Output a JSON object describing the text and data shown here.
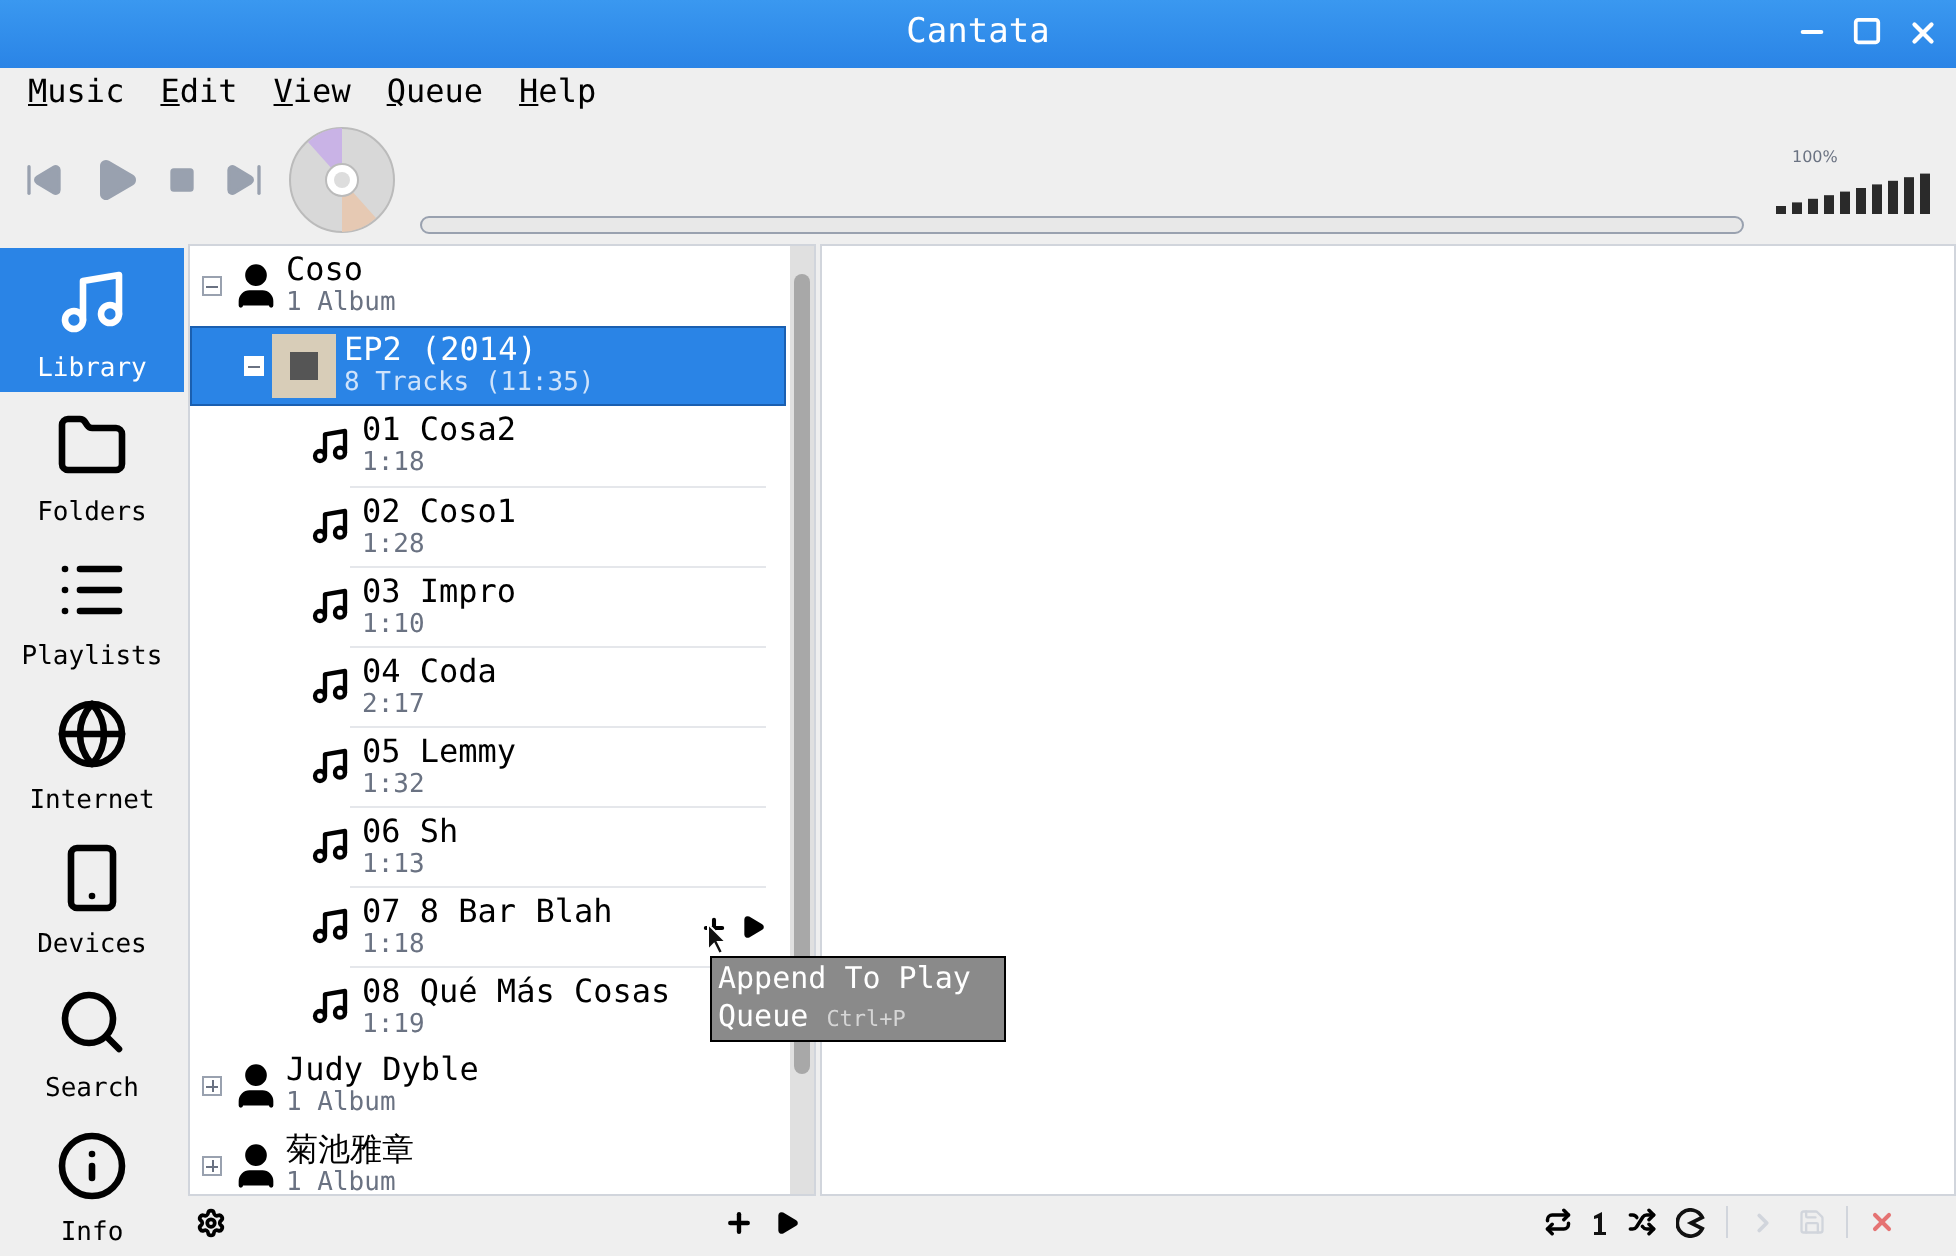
{
  "window": {
    "title": "Cantata"
  },
  "menu": [
    {
      "label": "Music"
    },
    {
      "label": "Edit"
    },
    {
      "label": "View"
    },
    {
      "label": "Queue"
    },
    {
      "label": "Help"
    }
  ],
  "position": {
    "level": 0
  },
  "volume": {
    "reading": "100%",
    "level": 1.0
  },
  "sidebar": [
    {
      "label": "Library",
      "selected": true
    },
    {
      "label": "Folders",
      "selected": false
    },
    {
      "label": "Playlists",
      "selected": false
    },
    {
      "label": "Internet",
      "selected": false
    },
    {
      "label": "Devices",
      "selected": false
    },
    {
      "label": "Search",
      "selected": false
    },
    {
      "label": "Info",
      "selected": false
    }
  ],
  "tree": [
    {
      "name": "Coso",
      "info": "1 Album",
      "expanded": true,
      "albums": [
        {
          "title": "EP2 (2014)",
          "info": "8 Tracks (11:35)",
          "selected": true,
          "expanded": true,
          "tracks": [
            {
              "title": "01 Cosa2",
              "time": "1:18",
              "hovered": false
            },
            {
              "title": "02 Coso1",
              "time": "1:28",
              "hovered": false
            },
            {
              "title": "03 Impro",
              "time": "1:10",
              "hovered": false
            },
            {
              "title": "04 Coda",
              "time": "2:17",
              "hovered": false
            },
            {
              "title": "05 Lemmy",
              "time": "1:32",
              "hovered": false
            },
            {
              "title": "06 Sh",
              "time": "1:13",
              "hovered": false
            },
            {
              "title": "07 8 Bar Blah",
              "time": "1:18",
              "hovered": true
            },
            {
              "title": "08 Qué Más Cosas",
              "time": "1:19",
              "hovered": false
            }
          ]
        }
      ]
    },
    {
      "name": "Judy Dyble",
      "info": "1 Album",
      "expanded": false
    },
    {
      "name": "菊池雅章",
      "info": "1 Album",
      "expanded": false
    }
  ],
  "tooltip": {
    "text": "Append To Play Queue",
    "shortcut": "Ctrl+P"
  }
}
